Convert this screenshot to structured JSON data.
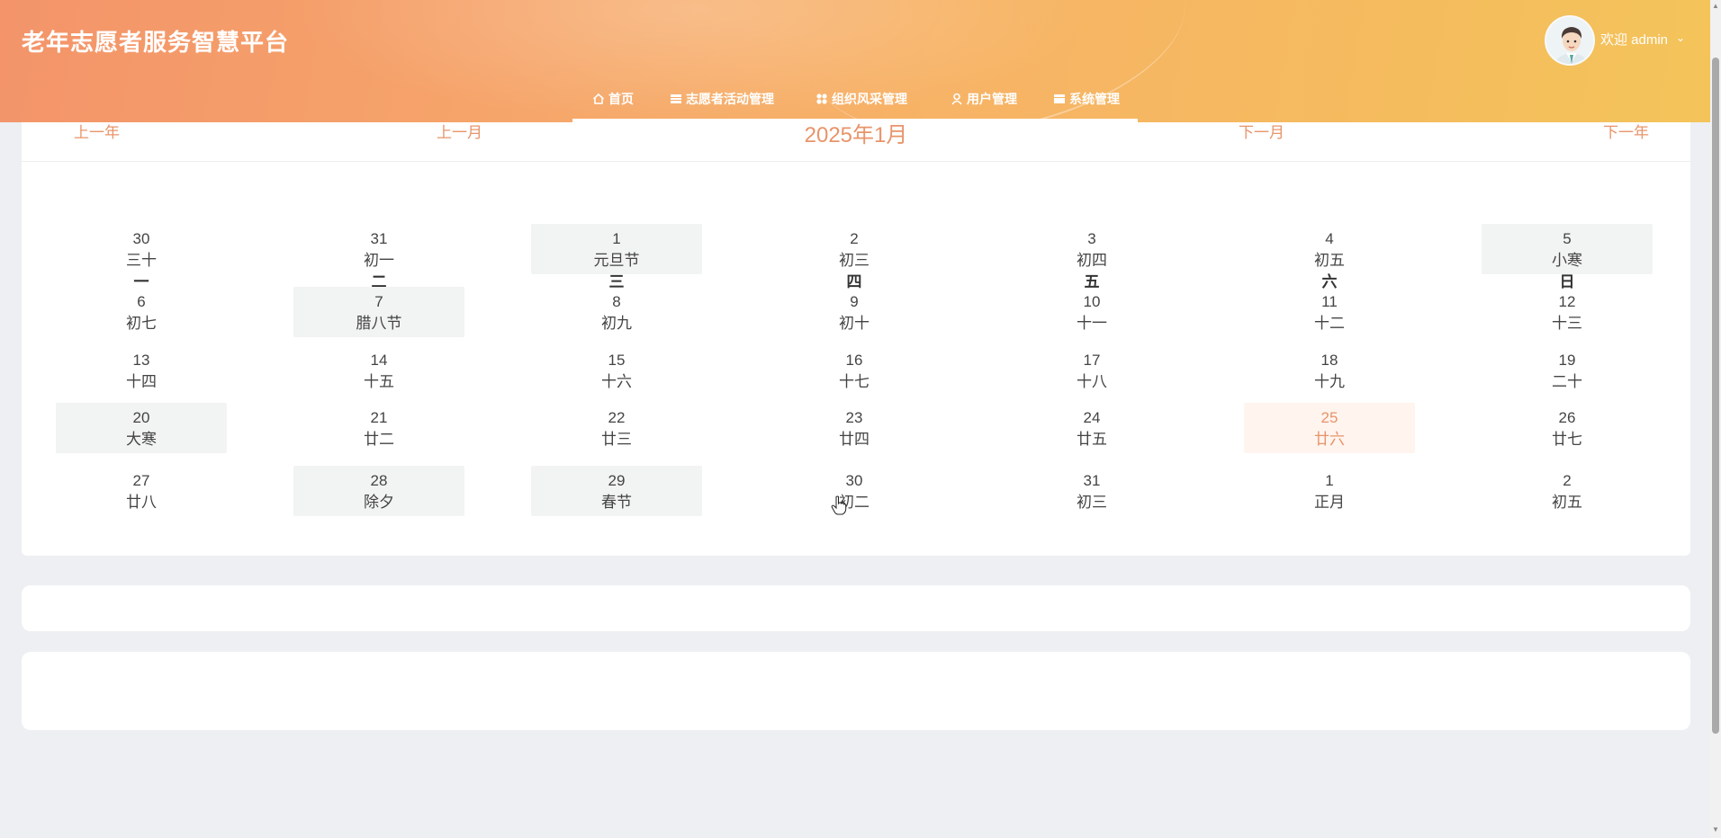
{
  "header": {
    "title": "老年志愿者服务智慧平台",
    "welcome": "欢迎 admin",
    "menu": [
      {
        "label": "首页",
        "icon": "home-icon"
      },
      {
        "label": "志愿者活动管理",
        "icon": "table-icon"
      },
      {
        "label": "组织风采管理",
        "icon": "grid-icon"
      },
      {
        "label": "用户管理",
        "icon": "user-icon"
      },
      {
        "label": "系统管理",
        "icon": "table-icon"
      }
    ]
  },
  "calendar": {
    "prev_year": "上一年",
    "prev_month": "上一月",
    "title": "2025年1月",
    "next_month": "下一月",
    "next_year": "下一年",
    "weekdays": [
      "一",
      "二",
      "三",
      "四",
      "五",
      "六",
      "日"
    ],
    "weeks": [
      [
        {
          "num": "30",
          "lunar": "三十"
        },
        {
          "num": "31",
          "lunar": "初一"
        },
        {
          "num": "1",
          "lunar": "元旦节",
          "marked": true
        },
        {
          "num": "2",
          "lunar": "初三"
        },
        {
          "num": "3",
          "lunar": "初四"
        },
        {
          "num": "4",
          "lunar": "初五"
        },
        {
          "num": "5",
          "lunar": "小寒",
          "marked": true
        }
      ],
      [
        {
          "num": "6",
          "lunar": "初七"
        },
        {
          "num": "7",
          "lunar": "腊八节",
          "marked": true
        },
        {
          "num": "8",
          "lunar": "初九"
        },
        {
          "num": "9",
          "lunar": "初十"
        },
        {
          "num": "10",
          "lunar": "十一"
        },
        {
          "num": "11",
          "lunar": "十二"
        },
        {
          "num": "12",
          "lunar": "十三"
        }
      ],
      [
        {
          "num": "13",
          "lunar": "十四"
        },
        {
          "num": "14",
          "lunar": "十五"
        },
        {
          "num": "15",
          "lunar": "十六"
        },
        {
          "num": "16",
          "lunar": "十七"
        },
        {
          "num": "17",
          "lunar": "十八"
        },
        {
          "num": "18",
          "lunar": "十九"
        },
        {
          "num": "19",
          "lunar": "二十"
        }
      ],
      [
        {
          "num": "20",
          "lunar": "大寒",
          "marked": true
        },
        {
          "num": "21",
          "lunar": "廿二"
        },
        {
          "num": "22",
          "lunar": "廿三"
        },
        {
          "num": "23",
          "lunar": "廿四"
        },
        {
          "num": "24",
          "lunar": "廿五"
        },
        {
          "num": "25",
          "lunar": "廿六",
          "today": true
        },
        {
          "num": "26",
          "lunar": "廿七"
        }
      ],
      [
        {
          "num": "27",
          "lunar": "廿八"
        },
        {
          "num": "28",
          "lunar": "除夕",
          "marked": true
        },
        {
          "num": "29",
          "lunar": "春节",
          "marked": true
        },
        {
          "num": "30",
          "lunar": "初二"
        },
        {
          "num": "31",
          "lunar": "初三"
        },
        {
          "num": "1",
          "lunar": "正月"
        },
        {
          "num": "2",
          "lunar": "初五"
        }
      ]
    ]
  },
  "colors": {
    "accent": "#e8946a",
    "today_bg": "#fff4ee",
    "marked_bg": "#f2f3f3",
    "header_start": "#f3946a",
    "header_end": "#f4c45a"
  }
}
